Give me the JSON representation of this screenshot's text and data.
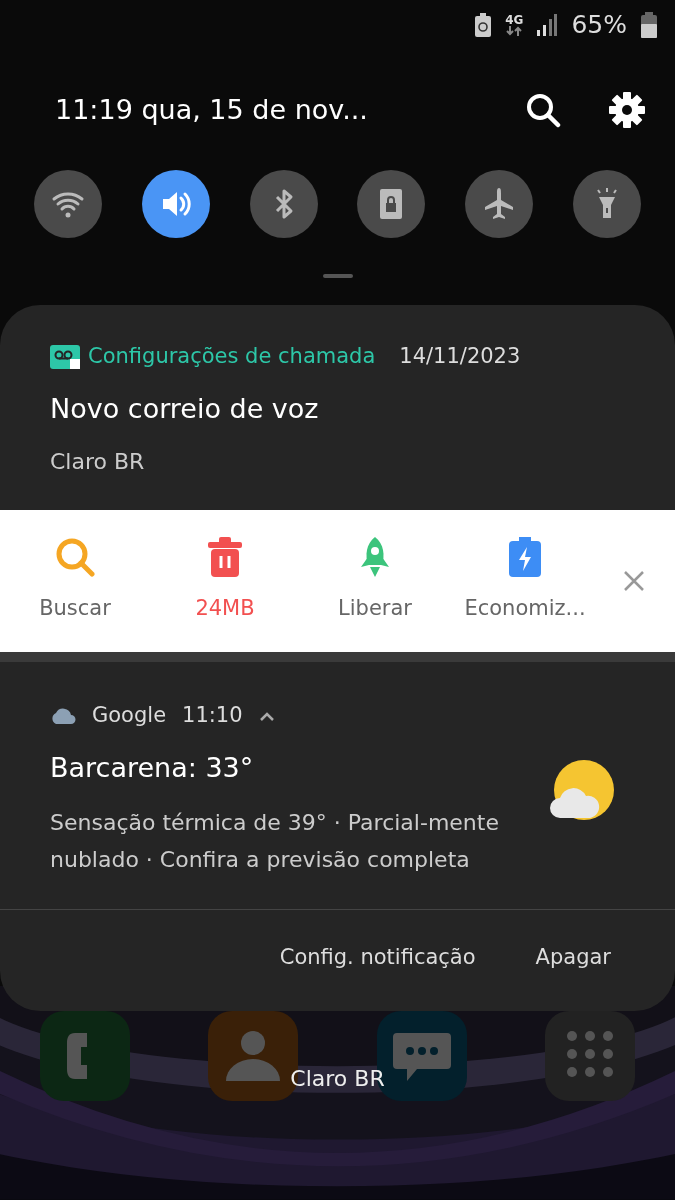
{
  "status_bar": {
    "network": "4G",
    "battery": "65%"
  },
  "header": {
    "datetime": "11:19  qua, 15 de nov..."
  },
  "quick_toggles": [
    {
      "kind": "wifi",
      "on": false
    },
    {
      "kind": "sound",
      "on": true
    },
    {
      "kind": "bluetooth",
      "on": false
    },
    {
      "kind": "lock",
      "on": false
    },
    {
      "kind": "airplane",
      "on": false
    },
    {
      "kind": "flashlight",
      "on": false
    }
  ],
  "call_notification": {
    "app": "Configurações de chamada",
    "time": "14/11/2023",
    "title": "Novo correio de voz",
    "text": "Claro BR"
  },
  "cleaner": {
    "actions": [
      {
        "kind": "search",
        "label": "Buscar",
        "color": "#f5a623",
        "alert": false
      },
      {
        "kind": "trash",
        "label": "24MB",
        "color": "#f25050",
        "alert": true
      },
      {
        "kind": "rocket",
        "label": "Liberar",
        "color": "#3cc47c",
        "alert": false
      },
      {
        "kind": "battery",
        "label": "Economiz...",
        "color": "#3d8df5",
        "alert": false
      }
    ]
  },
  "weather_notification": {
    "app": "Google",
    "time": "11:10",
    "expanded": true,
    "title": "Barcarena: 33°",
    "text": "Sensação térmica de 39° · Parcial-mente nublado · Confira a previsão completa"
  },
  "notification_buttons": [
    "Config. notificação",
    "Apagar"
  ],
  "home": {
    "carrier": "Claro BR"
  }
}
